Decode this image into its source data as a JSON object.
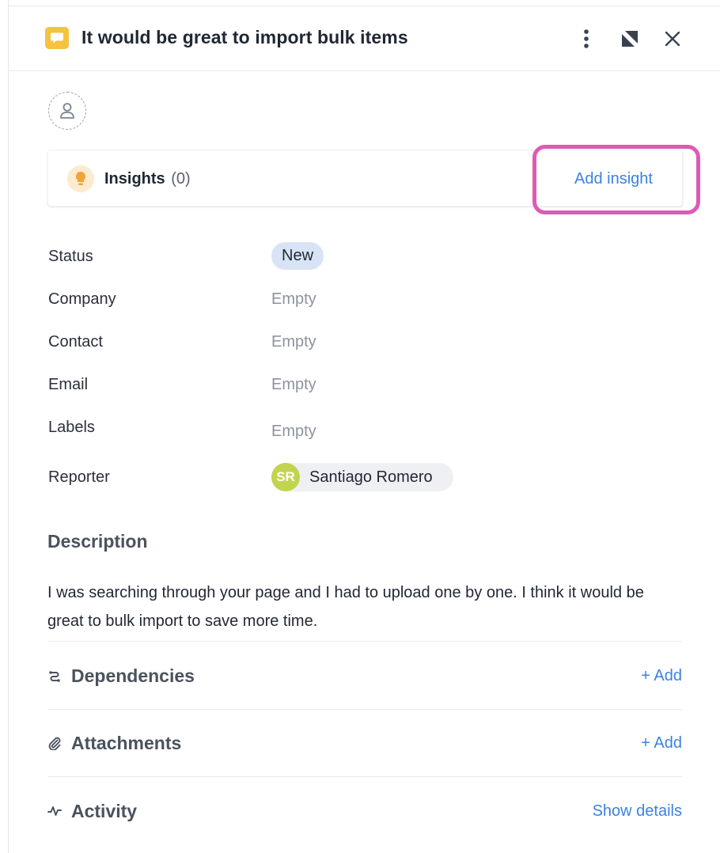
{
  "panel": {
    "title": "It would be great to import bulk items",
    "type_icon": "speech-bubble-icon",
    "accent": "#f5c242"
  },
  "header_actions": {
    "more": "more-vertical-icon",
    "expand": "expand-icon",
    "close": "close-icon"
  },
  "assignee": {
    "icon": "user-icon"
  },
  "insights": {
    "label": "Insights",
    "count": "(0)",
    "add_label": "Add insight",
    "icon": "lightbulb-icon"
  },
  "fields": {
    "status": {
      "label": "Status",
      "value": "New"
    },
    "company": {
      "label": "Company",
      "value": "Empty"
    },
    "contact": {
      "label": "Contact",
      "value": "Empty"
    },
    "email": {
      "label": "Email",
      "value": "Empty"
    },
    "labels": {
      "label": "Labels",
      "value": "Empty"
    },
    "reporter": {
      "label": "Reporter",
      "initials": "SR",
      "name": "Santiago Romero"
    }
  },
  "description": {
    "title": "Description",
    "text": "I was searching through your page and I had to upload one by one. I think it would be great to bulk import to save more time."
  },
  "sections": {
    "dependencies": {
      "title": "Dependencies",
      "action": "+ Add",
      "icon": "dependencies-icon"
    },
    "attachments": {
      "title": "Attachments",
      "action": "+ Add",
      "icon": "paperclip-icon"
    },
    "activity": {
      "title": "Activity",
      "action": "Show details",
      "icon": "activity-icon"
    }
  },
  "colors": {
    "link": "#3b82e0",
    "highlight": "#dc5bb3",
    "status_chip": "#d8e4f5",
    "avatar": "#c2d44e"
  }
}
